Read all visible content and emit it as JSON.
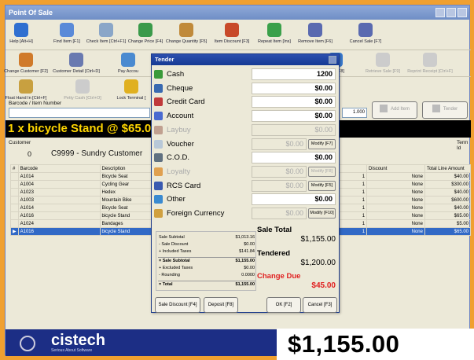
{
  "window": {
    "title": "Point Of Sale"
  },
  "toolbar1": [
    {
      "label": "Help [Alt+H]",
      "icon": "help-icon",
      "color": "#2f6fd0"
    },
    {
      "label": "Find Item [F1]",
      "icon": "magnifier-icon",
      "color": "#5a8ad8"
    },
    {
      "label": "Check Item [Ctrl+F1]",
      "icon": "document-search-icon",
      "color": "#8aa6c8"
    },
    {
      "label": "Change Price [F4]",
      "icon": "dollar-icon",
      "color": "#3a9a4a"
    },
    {
      "label": "Change Quantity [F5]",
      "icon": "boxes-icon",
      "color": "#c08a3a"
    },
    {
      "label": "Item Discount [F3]",
      "icon": "percent-icon",
      "color": "#c84a2a"
    },
    {
      "label": "Repeat Item [Ins]",
      "icon": "repeat-arrow-icon",
      "color": "#3aa04a"
    },
    {
      "label": "Remove Item [F6]",
      "icon": "trash-icon",
      "color": "#5a6ab0"
    },
    {
      "label": "Cancel Sale [F7]",
      "icon": "trash-cancel-icon",
      "color": "#5a6ab0"
    }
  ],
  "toolbar2": [
    {
      "label": "Change Customer [F2]",
      "icon": "customer-icon",
      "color": "#d07a2a",
      "disabled": false
    },
    {
      "label": "Customer Detail [Ctrl+D]",
      "icon": "customer-detail-icon",
      "color": "#6a7ab0",
      "disabled": false
    },
    {
      "label": "Pay Accou",
      "icon": "pay-account-icon",
      "color": "#4a8ad0",
      "disabled": false
    },
    {
      "label": "Sale [F8]",
      "icon": "sale-icon",
      "color": "#3a7ad0",
      "disabled": false
    },
    {
      "label": "Retrieve Sale [F9]",
      "icon": "retrieve-sale-icon",
      "color": "#aaa",
      "disabled": true
    },
    {
      "label": "Reprint Receipt [Ctrl+F]",
      "icon": "reprint-icon",
      "color": "#aaa",
      "disabled": true
    }
  ],
  "toolbar3": [
    {
      "label": "Float Hand In [Ctrl+F]",
      "icon": "float-hand-in-icon",
      "color": "#c8a040",
      "disabled": false
    },
    {
      "label": "Petty Cash [Ctrl+O]",
      "icon": "petty-cash-icon",
      "color": "#aaa",
      "disabled": true
    },
    {
      "label": "Lock Terminal [",
      "icon": "lock-icon",
      "color": "#e0b020",
      "disabled": false
    }
  ],
  "barcode": {
    "label": "Barcode / Item Number",
    "value": ""
  },
  "quantity": "1.000",
  "add_item_label": "Add Item",
  "tender_label": "Tender",
  "banner": "1 x bicycle Stand @ $65.00",
  "customer": {
    "label": "Customer",
    "number": "0",
    "name": "C9999 - Sundry Customer"
  },
  "term_label": "Term Id",
  "grid": {
    "headers": [
      "#",
      "Barcode",
      "Description",
      "",
      "",
      "Discount",
      "Total Line Amount"
    ],
    "rows": [
      {
        "barcode": "A1014",
        "desc": "Bicycle Seat",
        "qty": "1",
        "discount": "None",
        "total": "$40.00"
      },
      {
        "barcode": "A1004",
        "desc": "Cycling Gear",
        "qty": "1",
        "discount": "None",
        "total": "$300.00"
      },
      {
        "barcode": "A1023",
        "desc": "Hedex",
        "qty": "1",
        "discount": "None",
        "total": "$40.00"
      },
      {
        "barcode": "A1003",
        "desc": "Mountain Bike",
        "qty": "1",
        "discount": "None",
        "total": "$600.00"
      },
      {
        "barcode": "A1014",
        "desc": "Bicycle Seat",
        "qty": "1",
        "discount": "None",
        "total": "$40.00"
      },
      {
        "barcode": "A1016",
        "desc": "bicycle Stand",
        "qty": "1",
        "discount": "None",
        "total": "$65.00"
      },
      {
        "barcode": "A1024",
        "desc": "Bandages",
        "qty": "1",
        "discount": "None",
        "total": "$5.00"
      },
      {
        "barcode": "A1016",
        "desc": "bicycle Stand",
        "qty": "1",
        "discount": "None",
        "total": "$65.00",
        "selected": true
      }
    ]
  },
  "brand": {
    "name": "cistech",
    "tagline": "Serious About Software"
  },
  "grand_total": "$1,155.00",
  "tender": {
    "title": "Tender",
    "rows": [
      {
        "name": "Cash",
        "icon": "cash-icon",
        "color": "#3a9a3a",
        "value": "1200",
        "readonly": false,
        "modify": null,
        "dim": false
      },
      {
        "name": "Cheque",
        "icon": "cheque-icon",
        "color": "#3a6ab0",
        "value": "$0.00",
        "readonly": false,
        "modify": null,
        "dim": false
      },
      {
        "name": "Credit Card",
        "icon": "credit-card-icon",
        "color": "#c03a3a",
        "value": "$0.00",
        "readonly": false,
        "modify": null,
        "dim": false
      },
      {
        "name": "Account",
        "icon": "account-icon",
        "color": "#4a6ad0",
        "value": "$0.00",
        "readonly": false,
        "modify": null,
        "dim": false
      },
      {
        "name": "Laybuy",
        "icon": "laybuy-icon",
        "color": "#c0a090",
        "value": "$0.00",
        "readonly": false,
        "modify": null,
        "dim": true
      },
      {
        "name": "Voucher",
        "icon": "voucher-icon",
        "color": "#b8c8d8",
        "value": "$0.00",
        "readonly": true,
        "modify": "Modify [F7]",
        "modify_disabled": false,
        "dim": false
      },
      {
        "name": "C.O.D.",
        "icon": "cod-truck-icon",
        "color": "#607080",
        "value": "$0.00",
        "readonly": false,
        "modify": null,
        "dim": false
      },
      {
        "name": "Loyalty",
        "icon": "loyalty-icon",
        "color": "#e0a050",
        "value": "$0.00",
        "readonly": true,
        "modify": "Modify [F8]",
        "modify_disabled": true,
        "dim": true
      },
      {
        "name": "RCS Card",
        "icon": "rcs-card-icon",
        "color": "#3a5ab0",
        "value": "$0.00",
        "readonly": true,
        "modify": "Modify [F5]",
        "modify_disabled": false,
        "dim": false
      },
      {
        "name": "Other",
        "icon": "other-icon",
        "color": "#3a8ad0",
        "value": "$0.00",
        "readonly": false,
        "modify": null,
        "dim": false
      },
      {
        "name": "Foreign Currency",
        "icon": "foreign-currency-icon",
        "color": "#d0a040",
        "value": "$0.00",
        "readonly": true,
        "modify": "Modify [F10]",
        "modify_disabled": false,
        "dim": false
      }
    ],
    "summary": [
      {
        "label": "Sale Subtotal",
        "value": "$1,013.16",
        "bold": false
      },
      {
        "label": "- Sale Discount",
        "value": "$0.00",
        "bold": false
      },
      {
        "label": "+ Included Taxes",
        "value": "$141.84",
        "bold": false
      },
      {
        "label": "= Sale Subtotal",
        "value": "$1,155.00",
        "bold": true
      },
      {
        "label": "+ Excluded Taxes",
        "value": "$0.00",
        "bold": false
      },
      {
        "label": "- Rounding",
        "value": "0.0000",
        "bold": false
      },
      {
        "label": "= Total",
        "value": "$1,155.00",
        "bold": true
      }
    ],
    "sale_total_label": "Sale Total",
    "sale_total": "$1,155.00",
    "tendered_label": "Tendered",
    "tendered": "$1,200.00",
    "change_due_label": "Change Due",
    "change_due": "$45.00",
    "buttons": {
      "sale_discount": "Sale Discount [F4]",
      "deposit": "Deposit [F8]",
      "ok": "OK [F2]",
      "cancel": "Cancel [F3]"
    }
  },
  "colors": {
    "banner_text": "#ffd600",
    "change_due": "#e02020",
    "selected_row": "#3169c6",
    "footer": "#1c2e85"
  }
}
